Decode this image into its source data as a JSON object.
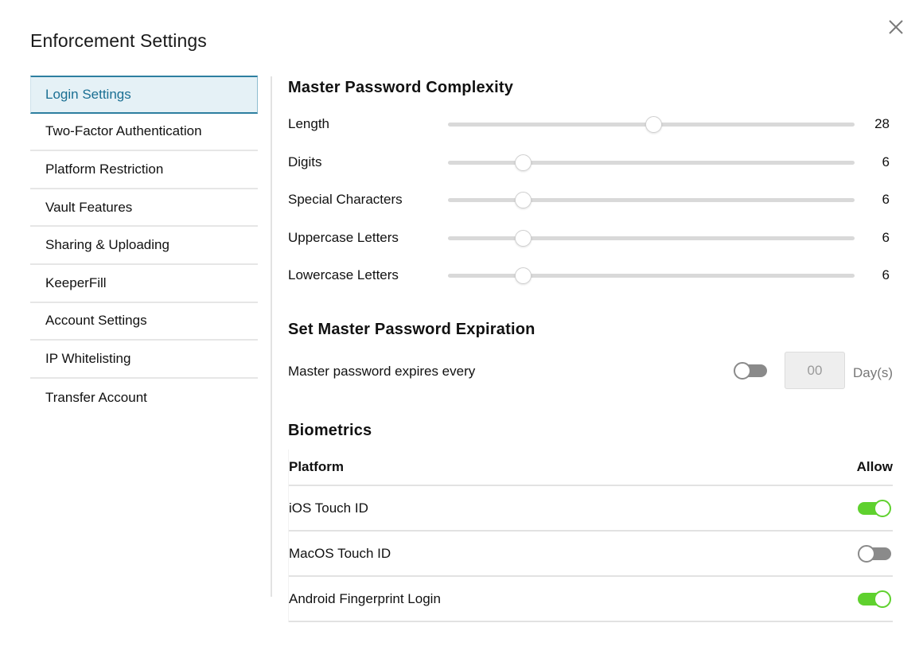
{
  "dialog": {
    "title": "Enforcement Settings",
    "close_icon": "close-icon"
  },
  "sidebar": {
    "items": [
      {
        "label": "Login Settings",
        "active": true
      },
      {
        "label": "Two-Factor Authentication",
        "active": false
      },
      {
        "label": "Platform Restriction",
        "active": false
      },
      {
        "label": "Vault Features",
        "active": false
      },
      {
        "label": "Sharing & Uploading",
        "active": false
      },
      {
        "label": "KeeperFill",
        "active": false
      },
      {
        "label": "Account Settings",
        "active": false
      },
      {
        "label": "IP Whitelisting",
        "active": false
      },
      {
        "label": "Transfer Account",
        "active": false
      }
    ]
  },
  "complexity": {
    "title": "Master Password Complexity",
    "sliders": [
      {
        "label": "Length",
        "value": "28",
        "fraction": 0.504
      },
      {
        "label": "Digits",
        "value": "6",
        "fraction": 0.184
      },
      {
        "label": "Special Characters",
        "value": "6",
        "fraction": 0.184
      },
      {
        "label": "Uppercase Letters",
        "value": "6",
        "fraction": 0.184
      },
      {
        "label": "Lowercase Letters",
        "value": "6",
        "fraction": 0.184
      }
    ]
  },
  "expiration": {
    "title": "Set Master Password Expiration",
    "label": "Master password expires every",
    "enabled": false,
    "days_value": "00",
    "unit": "Day(s)"
  },
  "biometrics": {
    "title": "Biometrics",
    "columns": [
      "Platform",
      "Allow"
    ],
    "rows": [
      {
        "platform": "iOS Touch ID",
        "allow": true
      },
      {
        "platform": "MacOS Touch ID",
        "allow": false
      },
      {
        "platform": "Android Fingerprint Login",
        "allow": true
      }
    ]
  },
  "colors": {
    "accent": "#1a6f93",
    "active_bg": "#e5f1f6",
    "toggle_on": "#5fd12e",
    "toggle_off": "#8a8a8a"
  }
}
